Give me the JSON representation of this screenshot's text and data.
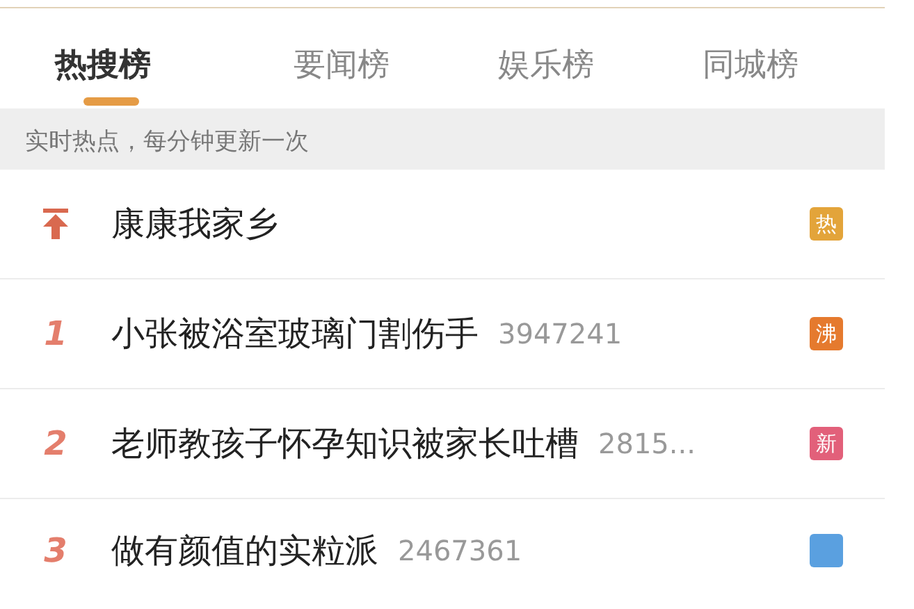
{
  "tabs": [
    {
      "label": "热搜榜",
      "selected": true
    },
    {
      "label": "要闻榜",
      "selected": false
    },
    {
      "label": "娱乐榜",
      "selected": false
    },
    {
      "label": "同城榜",
      "selected": false
    }
  ],
  "notice": "实时热点，每分钟更新一次",
  "items": [
    {
      "kind": "pinned",
      "title": "康康我家乡",
      "badge": "热",
      "color": "#e3a43a"
    },
    {
      "kind": "ranked",
      "rank": "1",
      "title": "小张被浴室玻璃门割伤手",
      "count": "3947241",
      "badge": "沸",
      "color": "#e57a2e"
    },
    {
      "kind": "ranked",
      "rank": "2",
      "title": "老师教孩子怀孕知识被家长吐槽",
      "count": "2815...",
      "badge": "新",
      "color": "#e2607a"
    },
    {
      "kind": "ranked",
      "rank": "3",
      "title": "做有颜值的实粒派",
      "count": "2467361",
      "color": "#5aa0e0"
    }
  ]
}
